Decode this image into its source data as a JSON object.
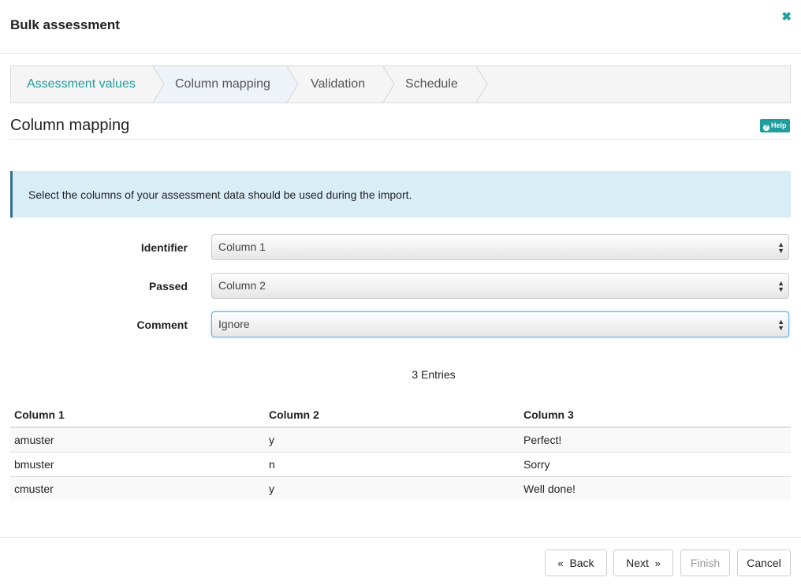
{
  "dialog": {
    "title": "Bulk assessment",
    "close_icon": "✖"
  },
  "wizard": {
    "steps": [
      {
        "label": "Assessment values",
        "state": "completed"
      },
      {
        "label": "Column mapping",
        "state": "active"
      },
      {
        "label": "Validation",
        "state": "pending"
      },
      {
        "label": "Schedule",
        "state": "pending"
      }
    ]
  },
  "section": {
    "title": "Column mapping",
    "help_label": "Help"
  },
  "info": {
    "text": "Select the columns of your assessment data should be used during the import."
  },
  "form": {
    "fields": [
      {
        "label": "Identifier",
        "value": "Column 1"
      },
      {
        "label": "Passed",
        "value": "Column 2"
      },
      {
        "label": "Comment",
        "value": "Ignore"
      }
    ]
  },
  "table": {
    "entries_label": "3 Entries",
    "headers": [
      "Column 1",
      "Column 2",
      "Column 3"
    ],
    "rows": [
      [
        "amuster",
        "y",
        "Perfect!"
      ],
      [
        "bmuster",
        "n",
        "Sorry"
      ],
      [
        "cmuster",
        "y",
        "Well done!"
      ]
    ]
  },
  "buttons": {
    "back": "Back",
    "next": "Next",
    "finish": "Finish",
    "cancel": "Cancel"
  },
  "colors": {
    "accent": "#209d9d",
    "info_bg": "#d9edf7",
    "info_border": "#31708f",
    "active_step_bg": "#eef3fa"
  }
}
